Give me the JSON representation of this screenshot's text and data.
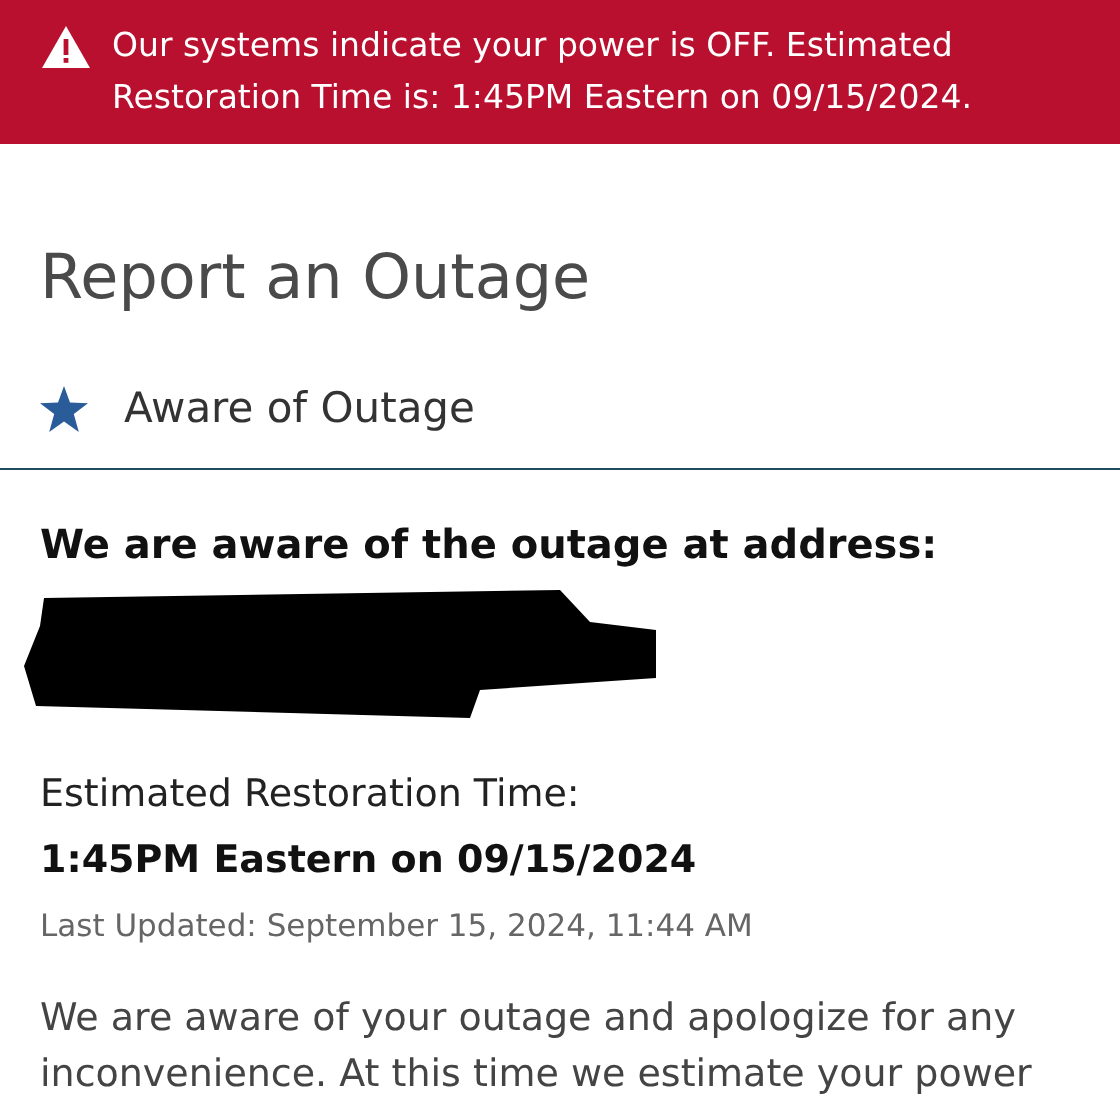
{
  "alert": {
    "text": "Our systems indicate your power is OFF. Estimated Restoration Time is: 1:45PM Eastern on 09/15/2024."
  },
  "title": "Report an Outage",
  "status": {
    "label": "Aware of Outage"
  },
  "heading": "We are aware of the outage at address:",
  "restoration": {
    "label": "Estimated Restoration Time:",
    "value": "1:45PM Eastern on 09/15/2024"
  },
  "last_updated": "Last Updated: September 15, 2024, 11:44 AM",
  "message": "We are aware of your outage and apologize for any inconvenience. At this time we estimate your power"
}
